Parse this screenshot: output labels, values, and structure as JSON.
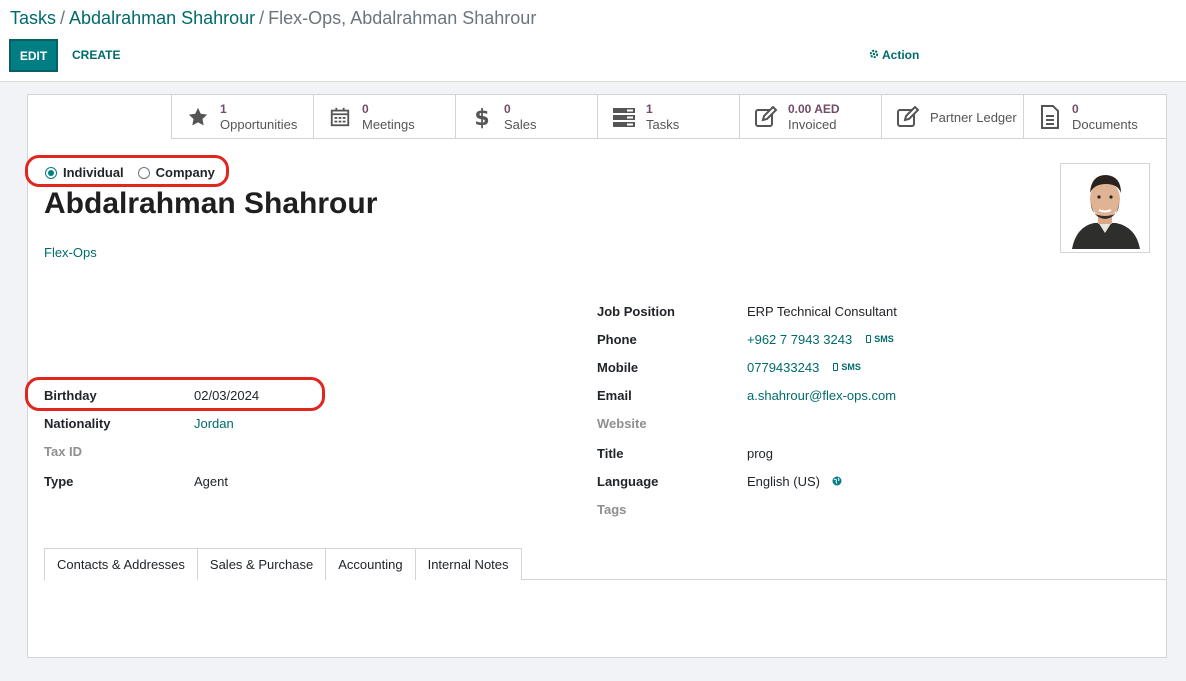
{
  "breadcrumb": {
    "items": [
      "Tasks",
      "Abdalrahman Shahrour"
    ],
    "separator": "/",
    "current": "Flex-Ops, Abdalrahman Shahrour"
  },
  "toolbar": {
    "edit_label": "EDIT",
    "create_label": "CREATE",
    "action_label": "Action"
  },
  "smart_buttons": [
    {
      "icon": "star-icon",
      "value": "1",
      "label": "Opportunities"
    },
    {
      "icon": "calendar-icon",
      "value": "0",
      "label": "Meetings"
    },
    {
      "icon": "dollar-icon",
      "value": "0",
      "label": "Sales"
    },
    {
      "icon": "tasks-icon",
      "value": "1",
      "label": "Tasks"
    },
    {
      "icon": "invoice-edit-icon",
      "value": "0.00 AED",
      "label": "Invoiced"
    },
    {
      "icon": "ledger-edit-icon",
      "value": "",
      "label": "Partner Ledger"
    },
    {
      "icon": "document-icon",
      "value": "0",
      "label": "Documents"
    }
  ],
  "company_type": {
    "options": [
      "Individual",
      "Company"
    ],
    "selected": "Individual"
  },
  "partner": {
    "name": "Abdalrahman Shahrour",
    "company": "Flex-Ops"
  },
  "left_fields": {
    "birthday": {
      "label": "Birthday",
      "value": "02/03/2024"
    },
    "nationality": {
      "label": "Nationality",
      "value": "Jordan"
    },
    "tax_id": {
      "label": "Tax ID",
      "value": ""
    },
    "type": {
      "label": "Type",
      "value": "Agent"
    }
  },
  "right_fields": {
    "job_position": {
      "label": "Job Position",
      "value": "ERP Technical Consultant"
    },
    "phone": {
      "label": "Phone",
      "value": "+962 7 7943 3243",
      "sms": "SMS"
    },
    "mobile": {
      "label": "Mobile",
      "value": "0779433243",
      "sms": "SMS"
    },
    "email": {
      "label": "Email",
      "value": "a.shahrour@flex-ops.com"
    },
    "website": {
      "label": "Website",
      "value": ""
    },
    "title": {
      "label": "Title",
      "value": "prog"
    },
    "language": {
      "label": "Language",
      "value": "English (US)"
    },
    "tags": {
      "label": "Tags",
      "value": ""
    }
  },
  "tabs": [
    {
      "label": "Contacts & Addresses",
      "active": true
    },
    {
      "label": "Sales & Purchase",
      "active": false
    },
    {
      "label": "Accounting",
      "active": false
    },
    {
      "label": "Internal Notes",
      "active": false
    }
  ],
  "colors": {
    "accent": "#017e84",
    "link": "#016b6b",
    "stat_value": "#714b67",
    "highlight": "#e0271f"
  }
}
